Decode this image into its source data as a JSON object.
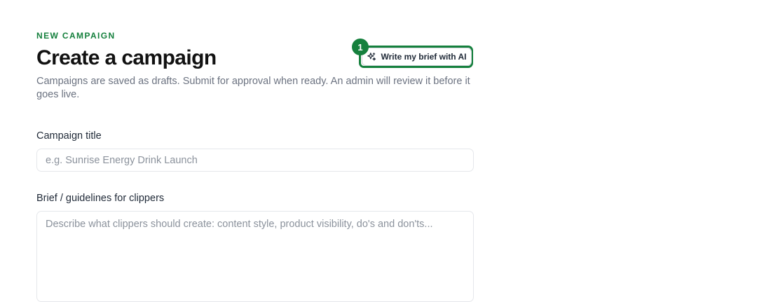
{
  "header": {
    "eyebrow": "NEW CAMPAIGN",
    "title": "Create a campaign",
    "subtitle": "Campaigns are saved as drafts. Submit for approval when ready. An admin will review it before it goes live."
  },
  "ai_button": {
    "label": "Write my brief with AI",
    "icon": "sparkles-icon",
    "step_badge": "1"
  },
  "form": {
    "campaign_title": {
      "label": "Campaign title",
      "value": "",
      "placeholder": "e.g. Sunrise Energy Drink Launch"
    },
    "brief": {
      "label": "Brief / guidelines for clippers",
      "value": "",
      "placeholder": "Describe what clippers should create: content style, product visibility, do's and don'ts..."
    }
  },
  "colors": {
    "accent": "#15803d",
    "text_muted": "#6b7280",
    "border": "#e5e7eb"
  }
}
